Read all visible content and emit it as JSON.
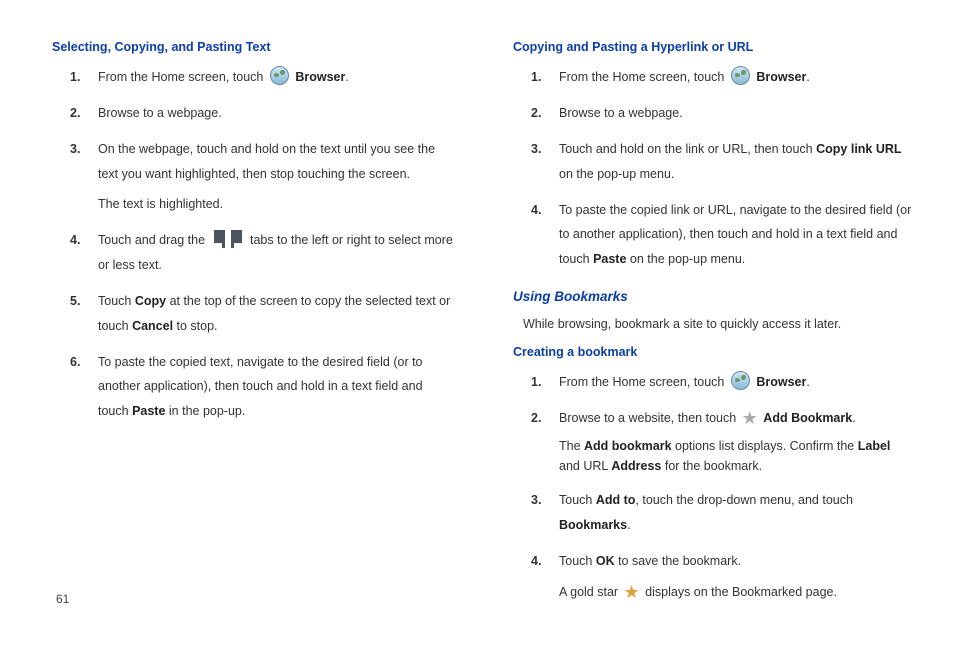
{
  "pageNumber": "61",
  "left": {
    "heading1": "Selecting, Copying, and Pasting Text",
    "s1": {
      "a": "From the Home screen, touch ",
      "b": "Browser",
      "c": "."
    },
    "s2": "Browse to a webpage.",
    "s3": "On the webpage, touch and hold on the text until you see the text you want highlighted, then stop touching the screen.",
    "s3b": "The text is highlighted.",
    "s4": {
      "a": "Touch and drag the ",
      "b": " tabs to the left or right to select more or less text."
    },
    "s5": {
      "a": "Touch ",
      "copy": "Copy",
      "b": " at the top of the screen to copy the selected text or touch ",
      "cancel": "Cancel",
      "c": " to stop."
    },
    "s6": {
      "a": "To paste the copied text, navigate to the desired field (or to another application), then touch and hold in a text field and touch ",
      "paste": "Paste",
      "b": " in the pop-up."
    }
  },
  "right": {
    "heading1": "Copying and Pasting a Hyperlink or URL",
    "s1": {
      "a": "From the Home screen, touch ",
      "b": "Browser",
      "c": "."
    },
    "s2": "Browse to a webpage.",
    "s3": {
      "a": "Touch and hold on the link or URL, then touch ",
      "copy": "Copy link URL",
      "b": " on the pop-up menu."
    },
    "s4": {
      "a": "To paste the copied link or URL, navigate to the desired field (or to another application), then touch and hold in a text field and touch ",
      "paste": "Paste",
      "b": " on the pop-up menu."
    },
    "heading2": "Using Bookmarks",
    "intro": "While browsing, bookmark a site to quickly access it later.",
    "heading3": "Creating a bookmark",
    "b1": {
      "a": "From the Home screen, touch ",
      "b": "Browser",
      "c": "."
    },
    "b2": {
      "a": "Browse to a website, then touch ",
      "add": "Add Bookmark",
      "b": "."
    },
    "b2b": {
      "a": "The ",
      "ab": "Add bookmark",
      "b": " options list displays. Confirm the ",
      "label": "Label",
      "c": " and URL ",
      "addr": "Address",
      "d": " for the bookmark."
    },
    "b3": {
      "a": "Touch ",
      "addto": "Add to",
      "b": ", touch the drop-down menu, and touch ",
      "bm": "Bookmarks",
      "c": "."
    },
    "b4": {
      "a": "Touch ",
      "ok": "OK",
      "b": " to save the bookmark."
    },
    "b4b": {
      "a": "A gold star ",
      "b": " displays on the Bookmarked page."
    }
  }
}
